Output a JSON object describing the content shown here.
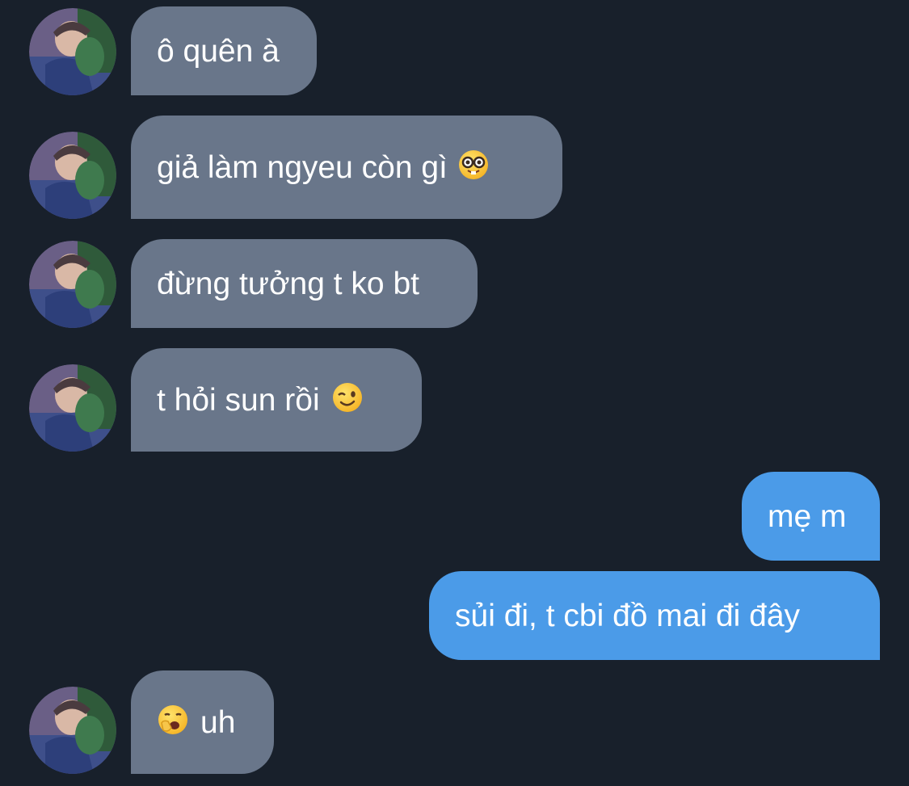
{
  "colors": {
    "background": "#18202b",
    "incoming_bubble": "#69768a",
    "outgoing_bubble": "#4b9be8",
    "text": "#ffffff"
  },
  "messages": [
    {
      "direction": "incoming",
      "text": "ô quên à",
      "emoji": null
    },
    {
      "direction": "incoming",
      "text": "giả làm ngyeu còn gì",
      "emoji": "nerd-face"
    },
    {
      "direction": "incoming",
      "text": "đừng tưởng t ko bt",
      "emoji": null
    },
    {
      "direction": "incoming",
      "text": "t hỏi sun rồi",
      "emoji": "winking-face"
    },
    {
      "direction": "outgoing",
      "text": "mẹ m",
      "emoji": null
    },
    {
      "direction": "outgoing",
      "text": "sủi đi, t cbi đồ mai đi đây",
      "emoji": null
    },
    {
      "direction": "incoming",
      "text": "uh",
      "emoji": "yawning-face"
    }
  ]
}
